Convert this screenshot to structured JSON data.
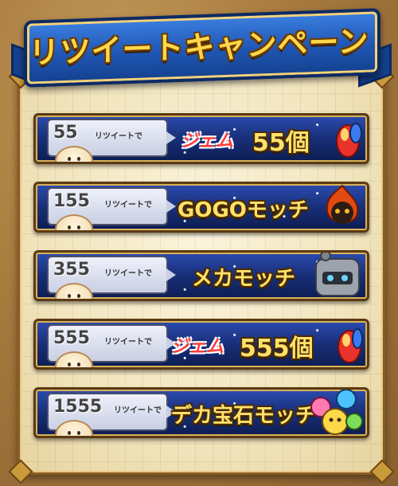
{
  "title": "リツイートキャンペーン",
  "rows": [
    {
      "count": "55",
      "suffix": "リツイートで",
      "gem_label": "ジェム",
      "reward": "55個",
      "icon": "gem-icon"
    },
    {
      "count": "155",
      "suffix": "リツイートで",
      "reward": "GOGOモッチ",
      "icon": "fire-mochi-icon"
    },
    {
      "count": "355",
      "suffix": "リツイートで",
      "reward": "メカモッチ",
      "icon": "robot-mochi-icon"
    },
    {
      "count": "555",
      "suffix": "リツイートで",
      "gem_label": "ジェム",
      "reward": "555個",
      "icon": "gem-icon"
    },
    {
      "count": "1555",
      "suffix": "リツイートで",
      "reward": "デカ宝石モッチ",
      "icon": "jewel-mochi-icon"
    }
  ],
  "colors": {
    "banner": "#1f56b4",
    "title_text": "#ffd84a",
    "row_bg": "#182f78",
    "parchment": "#f2e5bd",
    "gem_red": "#ff3a3a"
  }
}
